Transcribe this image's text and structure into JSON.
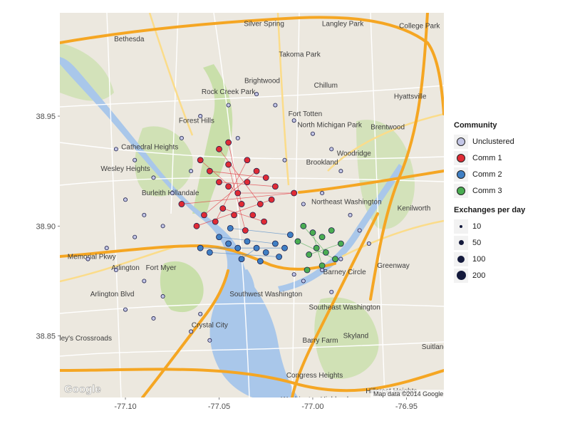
{
  "chart_data": {
    "type": "scatter",
    "title": "",
    "xlabel": "",
    "ylabel": "",
    "xlim": [
      -77.135,
      -76.93
    ],
    "ylim": [
      38.822,
      38.997
    ],
    "x_ticks": [
      "-77.10",
      "-77.05",
      "-77.00",
      "-76.95"
    ],
    "x_tick_values": [
      -77.1,
      -77.05,
      -77.0,
      -76.95
    ],
    "y_ticks": [
      "38.85",
      "38.90",
      "38.95"
    ],
    "y_tick_values": [
      38.85,
      38.9,
      38.95
    ],
    "grid": false,
    "basemap": "Google road map",
    "legend_placement": "right",
    "series": [
      {
        "name": "Unclustered",
        "color": "#c3c6e6",
        "points": [
          [
            -77.105,
            38.935
          ],
          [
            -77.095,
            38.93
          ],
          [
            -77.085,
            38.922
          ],
          [
            -77.1,
            38.912
          ],
          [
            -77.09,
            38.905
          ],
          [
            -77.08,
            38.9
          ],
          [
            -77.095,
            38.895
          ],
          [
            -77.11,
            38.89
          ],
          [
            -77.12,
            38.885
          ],
          [
            -77.105,
            38.88
          ],
          [
            -77.09,
            38.875
          ],
          [
            -77.08,
            38.868
          ],
          [
            -77.1,
            38.862
          ],
          [
            -77.085,
            38.858
          ],
          [
            -77.065,
            38.852
          ],
          [
            -77.055,
            38.848
          ],
          [
            -77.06,
            38.86
          ],
          [
            -77.07,
            38.94
          ],
          [
            -77.06,
            38.95
          ],
          [
            -77.045,
            38.955
          ],
          [
            -77.03,
            38.96
          ],
          [
            -77.02,
            38.955
          ],
          [
            -77.01,
            38.948
          ],
          [
            -77.0,
            38.942
          ],
          [
            -76.99,
            38.935
          ],
          [
            -76.985,
            38.925
          ],
          [
            -76.995,
            38.915
          ],
          [
            -77.005,
            38.91
          ],
          [
            -76.98,
            38.905
          ],
          [
            -76.975,
            38.898
          ],
          [
            -76.97,
            38.892
          ],
          [
            -76.985,
            38.885
          ],
          [
            -76.995,
            38.88
          ],
          [
            -77.01,
            38.878
          ],
          [
            -77.005,
            38.875
          ],
          [
            -76.99,
            38.87
          ],
          [
            -77.075,
            38.915
          ],
          [
            -77.065,
            38.925
          ],
          [
            -77.04,
            38.94
          ],
          [
            -77.015,
            38.93
          ]
        ]
      },
      {
        "name": "Comm 1",
        "color": "#e02b35",
        "points": [
          [
            -77.06,
            38.93
          ],
          [
            -77.055,
            38.925
          ],
          [
            -77.05,
            38.92
          ],
          [
            -77.045,
            38.918
          ],
          [
            -77.04,
            38.915
          ],
          [
            -77.035,
            38.92
          ],
          [
            -77.03,
            38.925
          ],
          [
            -77.025,
            38.922
          ],
          [
            -77.02,
            38.918
          ],
          [
            -77.038,
            38.91
          ],
          [
            -77.042,
            38.905
          ],
          [
            -77.048,
            38.908
          ],
          [
            -77.052,
            38.902
          ],
          [
            -77.058,
            38.905
          ],
          [
            -77.032,
            38.905
          ],
          [
            -77.028,
            38.91
          ],
          [
            -77.022,
            38.912
          ],
          [
            -77.035,
            38.93
          ],
          [
            -77.05,
            38.935
          ],
          [
            -77.045,
            38.928
          ],
          [
            -77.01,
            38.915
          ],
          [
            -77.07,
            38.91
          ],
          [
            -77.062,
            38.9
          ],
          [
            -77.045,
            38.938
          ],
          [
            -77.036,
            38.898
          ],
          [
            -77.026,
            38.902
          ]
        ]
      },
      {
        "name": "Comm 2",
        "color": "#3f7fc4",
        "points": [
          [
            -77.05,
            38.895
          ],
          [
            -77.045,
            38.892
          ],
          [
            -77.04,
            38.89
          ],
          [
            -77.035,
            38.893
          ],
          [
            -77.03,
            38.89
          ],
          [
            -77.025,
            38.888
          ],
          [
            -77.02,
            38.892
          ],
          [
            -77.015,
            38.89
          ],
          [
            -77.055,
            38.888
          ],
          [
            -77.06,
            38.89
          ],
          [
            -77.038,
            38.885
          ],
          [
            -77.028,
            38.884
          ],
          [
            -77.018,
            38.886
          ],
          [
            -77.044,
            38.899
          ],
          [
            -77.012,
            38.896
          ]
        ]
      },
      {
        "name": "Comm 3",
        "color": "#4aad52",
        "points": [
          [
            -77.005,
            38.9
          ],
          [
            -77.0,
            38.897
          ],
          [
            -76.995,
            38.895
          ],
          [
            -76.99,
            38.898
          ],
          [
            -76.998,
            38.89
          ],
          [
            -76.993,
            38.888
          ],
          [
            -76.988,
            38.885
          ],
          [
            -77.002,
            38.887
          ],
          [
            -77.008,
            38.893
          ],
          [
            -76.985,
            38.892
          ],
          [
            -76.995,
            38.882
          ],
          [
            -77.003,
            38.88
          ]
        ]
      }
    ],
    "exchanges": [
      {
        "from": [
          -77.06,
          38.93
        ],
        "to": [
          -77.04,
          38.915
        ],
        "community": "Comm 1"
      },
      {
        "from": [
          -77.055,
          38.925
        ],
        "to": [
          -77.025,
          38.922
        ],
        "community": "Comm 1"
      },
      {
        "from": [
          -77.05,
          38.92
        ],
        "to": [
          -77.02,
          38.918
        ],
        "community": "Comm 1"
      },
      {
        "from": [
          -77.07,
          38.91
        ],
        "to": [
          -77.01,
          38.915
        ],
        "community": "Comm 1"
      },
      {
        "from": [
          -77.045,
          38.938
        ],
        "to": [
          -77.038,
          38.91
        ],
        "community": "Comm 1"
      },
      {
        "from": [
          -77.035,
          38.93
        ],
        "to": [
          -77.052,
          38.902
        ],
        "community": "Comm 1"
      },
      {
        "from": [
          -77.03,
          38.925
        ],
        "to": [
          -77.058,
          38.905
        ],
        "community": "Comm 1"
      },
      {
        "from": [
          -77.05,
          38.935
        ],
        "to": [
          -77.028,
          38.91
        ],
        "community": "Comm 1"
      },
      {
        "from": [
          -77.062,
          38.9
        ],
        "to": [
          -77.022,
          38.912
        ],
        "community": "Comm 1"
      },
      {
        "from": [
          -77.045,
          38.928
        ],
        "to": [
          -77.036,
          38.898
        ],
        "community": "Comm 1"
      },
      {
        "from": [
          -77.04,
          38.915
        ],
        "to": [
          -77.01,
          38.915
        ],
        "community": "Comm 1"
      },
      {
        "from": [
          -77.048,
          38.908
        ],
        "to": [
          -77.026,
          38.902
        ],
        "community": "Comm 1"
      },
      {
        "from": [
          -77.06,
          38.89
        ],
        "to": [
          -77.015,
          38.89
        ],
        "community": "Comm 2"
      },
      {
        "from": [
          -77.05,
          38.895
        ],
        "to": [
          -77.02,
          38.892
        ],
        "community": "Comm 2"
      },
      {
        "from": [
          -77.055,
          38.888
        ],
        "to": [
          -77.018,
          38.886
        ],
        "community": "Comm 2"
      },
      {
        "from": [
          -77.044,
          38.899
        ],
        "to": [
          -77.012,
          38.896
        ],
        "community": "Comm 2"
      },
      {
        "from": [
          -77.038,
          38.885
        ],
        "to": [
          -77.03,
          38.89
        ],
        "community": "Comm 2"
      },
      {
        "from": [
          -77.008,
          38.893
        ],
        "to": [
          -76.988,
          38.885
        ],
        "community": "Comm 3"
      },
      {
        "from": [
          -77.005,
          38.9
        ],
        "to": [
          -76.993,
          38.888
        ],
        "community": "Comm 3"
      },
      {
        "from": [
          -77.002,
          38.887
        ],
        "to": [
          -76.985,
          38.892
        ],
        "community": "Comm 3"
      },
      {
        "from": [
          -77.0,
          38.897
        ],
        "to": [
          -76.995,
          38.882
        ],
        "community": "Comm 3"
      }
    ],
    "legend": {
      "community_title": "Community",
      "communities": [
        {
          "label": "Unclustered",
          "color": "#c3c6e6"
        },
        {
          "label": "Comm 1",
          "color": "#e02b35"
        },
        {
          "label": "Comm 2",
          "color": "#3f7fc4"
        },
        {
          "label": "Comm 3",
          "color": "#4aad52"
        }
      ],
      "size_title": "Exchanges per day",
      "sizes": [
        "10",
        "50",
        "100",
        "200"
      ],
      "size_values": [
        10,
        50,
        100,
        200
      ]
    }
  },
  "map": {
    "attribution": "Map data ©2014 Google",
    "logo": "Google",
    "colors": {
      "land": "#ece8df",
      "park": "#c9dfaa",
      "water": "#a9c7ea",
      "highway": "#f5a623",
      "road": "#ffffff"
    },
    "place_labels": [
      {
        "text": "Bethesda",
        "lon": -77.098,
        "lat": 38.984
      },
      {
        "text": "Silver Spring",
        "lon": -77.026,
        "lat": 38.991
      },
      {
        "text": "Takoma Park",
        "lon": -77.007,
        "lat": 38.977
      },
      {
        "text": "Langley Park",
        "lon": -76.984,
        "lat": 38.991
      },
      {
        "text": "College Park",
        "lon": -76.943,
        "lat": 38.99
      },
      {
        "text": "Chillum",
        "lon": -76.993,
        "lat": 38.963
      },
      {
        "text": "Hyattsville",
        "lon": -76.948,
        "lat": 38.958
      },
      {
        "text": "Rock Creek Park",
        "lon": -77.045,
        "lat": 38.96
      },
      {
        "text": "Brightwood",
        "lon": -77.027,
        "lat": 38.965
      },
      {
        "text": "Forest Hills",
        "lon": -77.062,
        "lat": 38.947
      },
      {
        "text": "Fort Totten",
        "lon": -77.004,
        "lat": 38.95
      },
      {
        "text": "North Michigan Park",
        "lon": -76.991,
        "lat": 38.945
      },
      {
        "text": "Brentwood",
        "lon": -76.96,
        "lat": 38.944
      },
      {
        "text": "Cathedral Heights",
        "lon": -77.087,
        "lat": 38.935
      },
      {
        "text": "Wesley Heights",
        "lon": -77.1,
        "lat": 38.925
      },
      {
        "text": "Woodridge",
        "lon": -76.978,
        "lat": 38.932
      },
      {
        "text": "Brookland",
        "lon": -76.995,
        "lat": 38.928
      },
      {
        "text": "Burleith Hillandale",
        "lon": -77.076,
        "lat": 38.914
      },
      {
        "text": "Northeast Washington",
        "lon": -76.982,
        "lat": 38.91
      },
      {
        "text": "Kenilworth",
        "lon": -76.946,
        "lat": 38.907
      },
      {
        "text": "Arlington",
        "lon": -77.1,
        "lat": 38.88
      },
      {
        "text": "Fort Myer",
        "lon": -77.081,
        "lat": 38.88
      },
      {
        "text": "Southwest Washington",
        "lon": -77.025,
        "lat": 38.868
      },
      {
        "text": "Barney Circle",
        "lon": -76.983,
        "lat": 38.878
      },
      {
        "text": "Southeast Washington",
        "lon": -76.983,
        "lat": 38.862
      },
      {
        "text": "Greenway",
        "lon": -76.957,
        "lat": 38.881
      },
      {
        "text": "Bailey's Crossroads",
        "lon": -77.124,
        "lat": 38.848
      },
      {
        "text": "Crystal City",
        "lon": -77.055,
        "lat": 38.854
      },
      {
        "text": "Barry Farm",
        "lon": -76.996,
        "lat": 38.847
      },
      {
        "text": "Skyland",
        "lon": -76.977,
        "lat": 38.849
      },
      {
        "text": "Congress Heights",
        "lon": -76.999,
        "lat": 38.831
      },
      {
        "text": "Washington Highlands",
        "lon": -76.998,
        "lat": 38.82
      },
      {
        "text": "Hillcrest Heights",
        "lon": -76.958,
        "lat": 38.824
      },
      {
        "text": "Suitland",
        "lon": -76.935,
        "lat": 38.844
      },
      {
        "text": "Memorial Pkwy",
        "lon": -77.118,
        "lat": 38.885
      },
      {
        "text": "Arlington Blvd",
        "lon": -77.107,
        "lat": 38.868
      }
    ]
  }
}
